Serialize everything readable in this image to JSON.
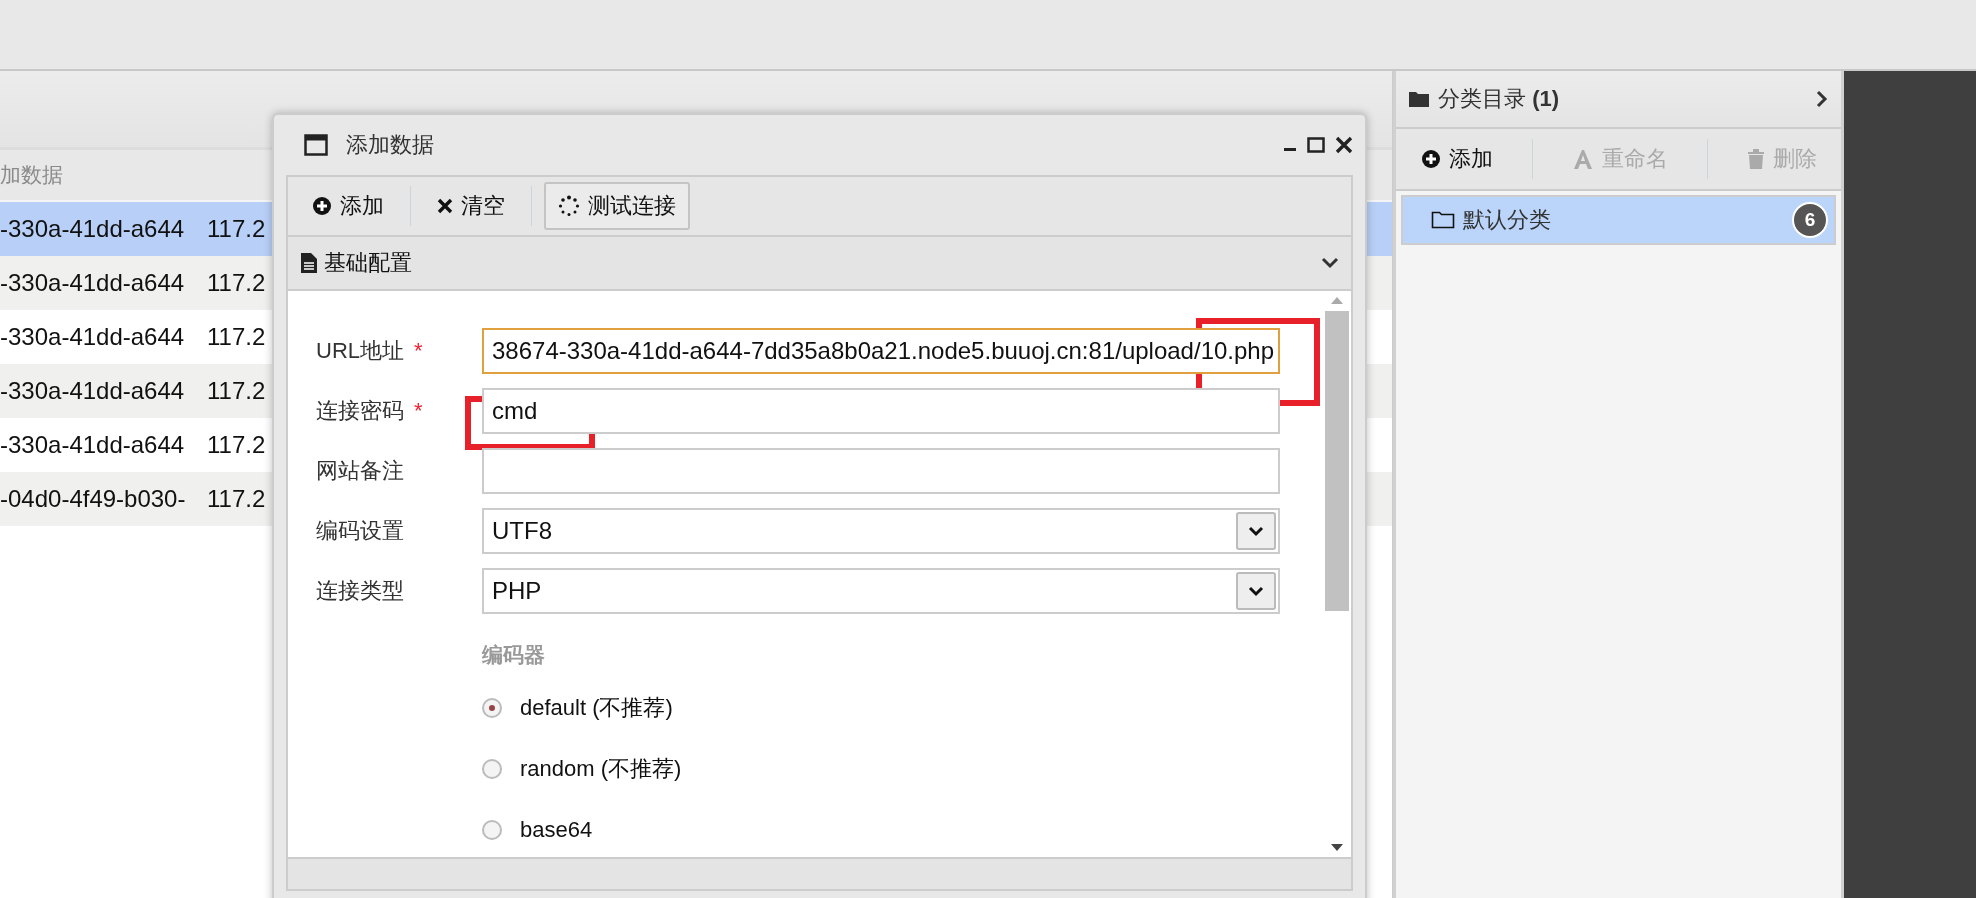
{
  "table": {
    "header": "加数据",
    "rows": [
      {
        "cells": [
          "-330a-41dd-a644",
          "117.2"
        ],
        "selected": true
      },
      {
        "cells": [
          "-330a-41dd-a644",
          "117.2"
        ],
        "selected": false
      },
      {
        "cells": [
          "-330a-41dd-a644",
          "117.2"
        ],
        "selected": false
      },
      {
        "cells": [
          "-330a-41dd-a644",
          "117.2"
        ],
        "selected": false
      },
      {
        "cells": [
          "-330a-41dd-a644",
          "117.2"
        ],
        "selected": false
      },
      {
        "cells": [
          "-04d0-4f49-b030-",
          "117.2"
        ],
        "selected": false
      }
    ]
  },
  "dialog": {
    "title": "添加数据",
    "toolbar": [
      {
        "kind": "add",
        "label": "添加",
        "pressed": false
      },
      {
        "kind": "clear",
        "label": "清空",
        "pressed": false
      },
      {
        "kind": "test",
        "label": "测试连接",
        "pressed": true
      }
    ],
    "section": {
      "title": "基础配置",
      "expanded": true
    },
    "fields": [
      {
        "kind": "text",
        "label": "URL地址",
        "marker": "*",
        "value": "38674-330a-41dd-a644-7dd35a8b0a21.node5.buuoj.cn:81/upload/10.php",
        "focused": true
      },
      {
        "kind": "text",
        "label": "连接密码",
        "marker": "*",
        "value": "cmd",
        "focused": false
      },
      {
        "kind": "text",
        "label": "网站备注",
        "focused": false
      },
      {
        "kind": "select",
        "label": "编码设置",
        "value": "UTF8"
      },
      {
        "kind": "select",
        "label": "连接类型",
        "value": "PHP"
      }
    ],
    "encoder": {
      "label": "编码器",
      "options": [
        {
          "label": "default (不推荐)",
          "selected": true
        },
        {
          "label": "random (不推荐)",
          "selected": false
        },
        {
          "label": "base64",
          "selected": false
        }
      ]
    }
  },
  "categories": {
    "title": "分类目录 **(1)**",
    "toolbar": [
      {
        "kind": "add",
        "label": "添加",
        "disabled": false
      },
      {
        "kind": "rename",
        "label": "重命名",
        "disabled": true
      },
      {
        "kind": "delete",
        "label": "删除",
        "disabled": true
      }
    ],
    "items": [
      {
        "label": "默认分类",
        "count": "6",
        "selected": true
      }
    ]
  }
}
